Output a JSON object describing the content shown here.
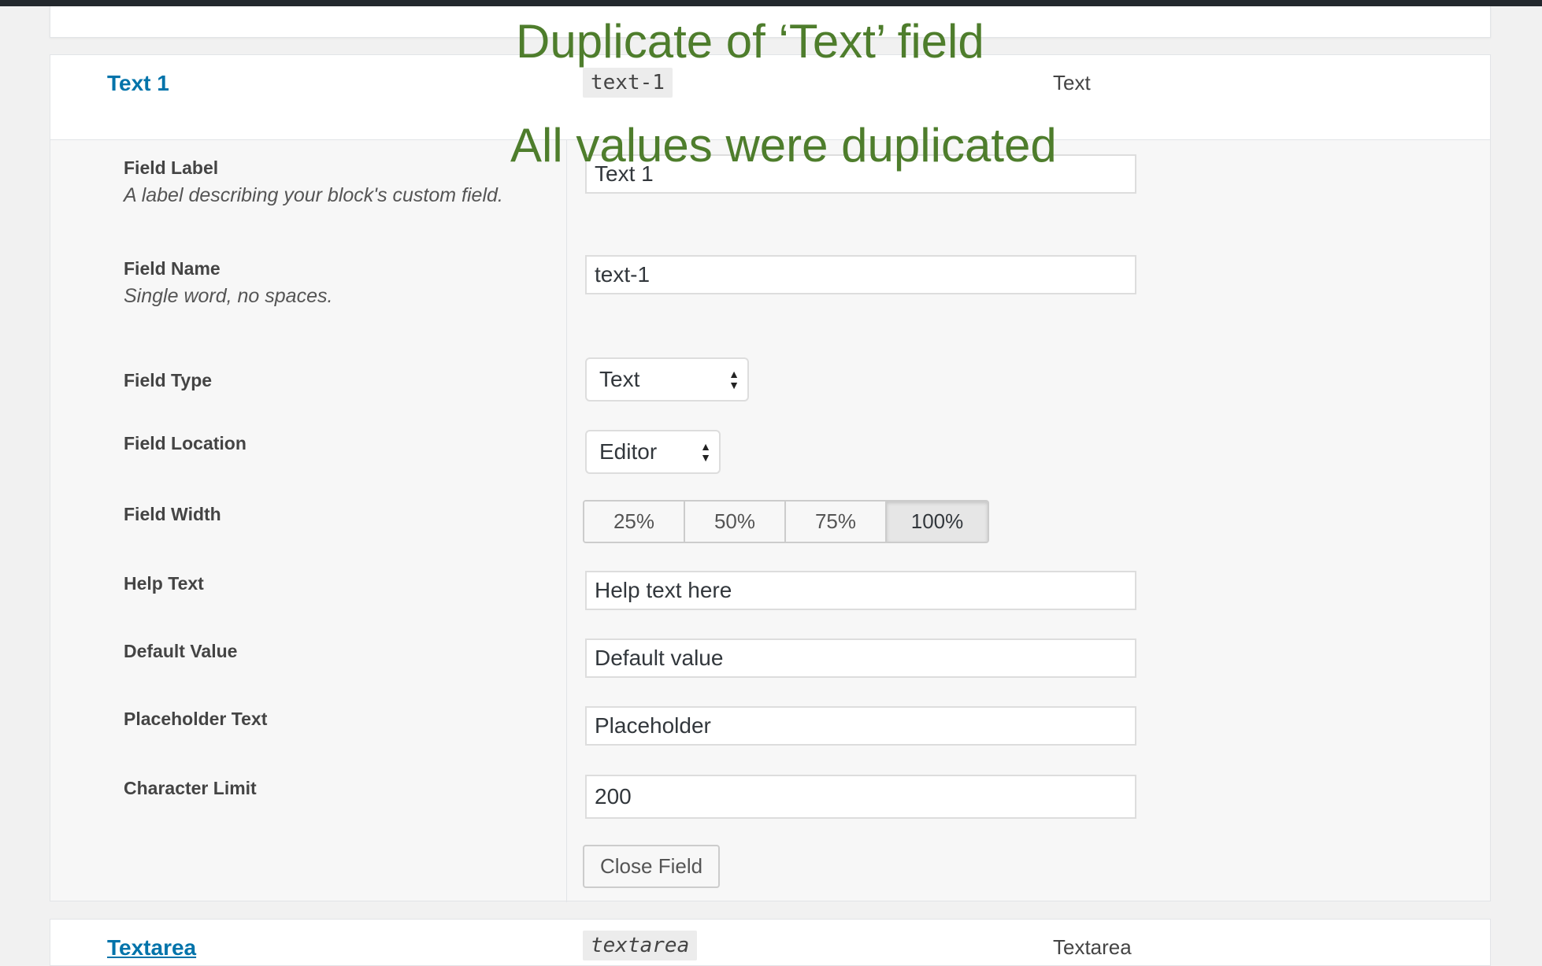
{
  "annotations": {
    "top": "Duplicate of ‘Text’ field",
    "middle": "All values were duplicated"
  },
  "field": {
    "title": "Text 1",
    "slug": "text-1",
    "type": "Text"
  },
  "labels": {
    "label": "Field Label",
    "label_desc": "A label describing your block's custom field.",
    "name": "Field Name",
    "name_desc": "Single word, no spaces.",
    "type": "Field Type",
    "location": "Field Location",
    "width": "Field Width",
    "help": "Help Text",
    "default": "Default Value",
    "placeholder": "Placeholder Text",
    "limit": "Character Limit"
  },
  "values": {
    "label": "Text 1",
    "name": "text-1",
    "type": "Text",
    "location": "Editor",
    "help": "Help text here",
    "default": "Default value",
    "placeholder": "Placeholder",
    "limit": "200"
  },
  "width_options": [
    "25%",
    "50%",
    "75%",
    "100%"
  ],
  "width_selected": "100%",
  "close_button": "Close Field",
  "next_field": {
    "title": "Textarea",
    "slug": "textarea",
    "type": "Textarea"
  }
}
